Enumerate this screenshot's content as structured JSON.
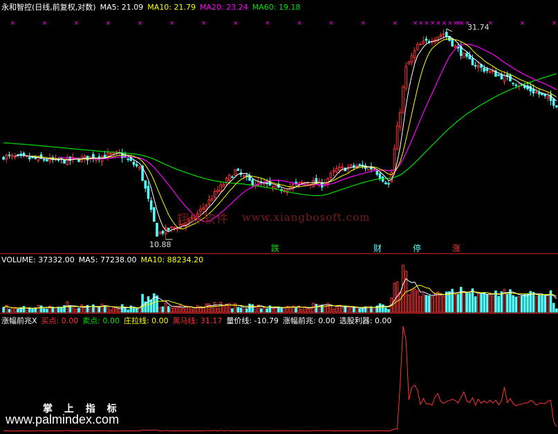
{
  "colors": {
    "up": "#ff3232",
    "down": "#54fcfc",
    "ma5": "#ffffff",
    "ma10": "#ffff00",
    "ma20": "#ff00ff",
    "ma60": "#00e000",
    "signal": "#ff00ff",
    "bg": "#000000"
  },
  "price_panel": {
    "legend": {
      "title": "永和智控(日线,前复权,对数)",
      "ma5_label": "MA5: 21.09",
      "ma10_label": "MA10: 21.79",
      "ma20_label": "MA20: 23.24",
      "ma60_label": "MA60: 19.18"
    },
    "high_label": "31.74",
    "low_label": "10.88",
    "event_tags": [
      "跌",
      "财",
      "停",
      "涨"
    ]
  },
  "volume_panel": {
    "legend": {
      "volume_label": "VOLUME: 37332.00",
      "ma5_label": "MA5: 77238.00",
      "ma10_label": "MA10: 88234.20"
    }
  },
  "indicator_panel": {
    "legend": {
      "name": "涨幅前兆X",
      "buy_label": "买点: 0.00",
      "sell_label": "卖点: 0.00",
      "zhuang_label": "庄拉线: 0.00",
      "heima_label": "黑马线: 31.17",
      "liangjia_label": "量价线: -10.79",
      "zhangfu_label": "涨幅前兆: 0.00",
      "xuangu_label": "选股利器: 0.00"
    }
  },
  "watermark": {
    "cn": "翔博软件",
    "url": "www.xiangbosoft.com"
  },
  "branding": {
    "cn": "掌 上 指 标",
    "url": "www.palmindex.com"
  },
  "chart_data": {
    "type": "candlestick",
    "log_scale": true,
    "price_range": [
      10.5,
      34
    ],
    "keypoints": [
      [
        0,
        16.6
      ],
      [
        10,
        16.4
      ],
      [
        20,
        16.2
      ],
      [
        30,
        16.5
      ],
      [
        40,
        16.8
      ],
      [
        47,
        15.6
      ],
      [
        51,
        12.5
      ],
      [
        53,
        11.2
      ],
      [
        58,
        11.5
      ],
      [
        65,
        12.0
      ],
      [
        70,
        13.0
      ],
      [
        75,
        14.2
      ],
      [
        80,
        15.4
      ],
      [
        85,
        14.6
      ],
      [
        90,
        14.4
      ],
      [
        95,
        14.0
      ],
      [
        100,
        14.3
      ],
      [
        105,
        14.6
      ],
      [
        110,
        14.4
      ],
      [
        115,
        15.5
      ],
      [
        122,
        15.8
      ],
      [
        128,
        15.6
      ],
      [
        130,
        15.0
      ],
      [
        133,
        14.4
      ],
      [
        134,
        15.3
      ],
      [
        137,
        21.0
      ],
      [
        139,
        26.0
      ],
      [
        141,
        27.5
      ],
      [
        143,
        29.0
      ],
      [
        148,
        30.2
      ],
      [
        152,
        31.0
      ],
      [
        156,
        29.0
      ],
      [
        160,
        27.2
      ],
      [
        165,
        26.0
      ],
      [
        170,
        25.2
      ],
      [
        175,
        24.5
      ],
      [
        180,
        23.5
      ],
      [
        185,
        22.8
      ],
      [
        191,
        21.6
      ]
    ],
    "seed": 7,
    "ma_periods": [
      5,
      10,
      20,
      60
    ],
    "ma_60_start": 17.8,
    "extremes": {
      "high": 31.74,
      "low": 10.88
    },
    "volume_latest": 37332.0,
    "volume_ma5": 77238.0,
    "volume_ma10": 88234.2,
    "indicator_series": "heima",
    "indicator_peak": 31.17
  }
}
